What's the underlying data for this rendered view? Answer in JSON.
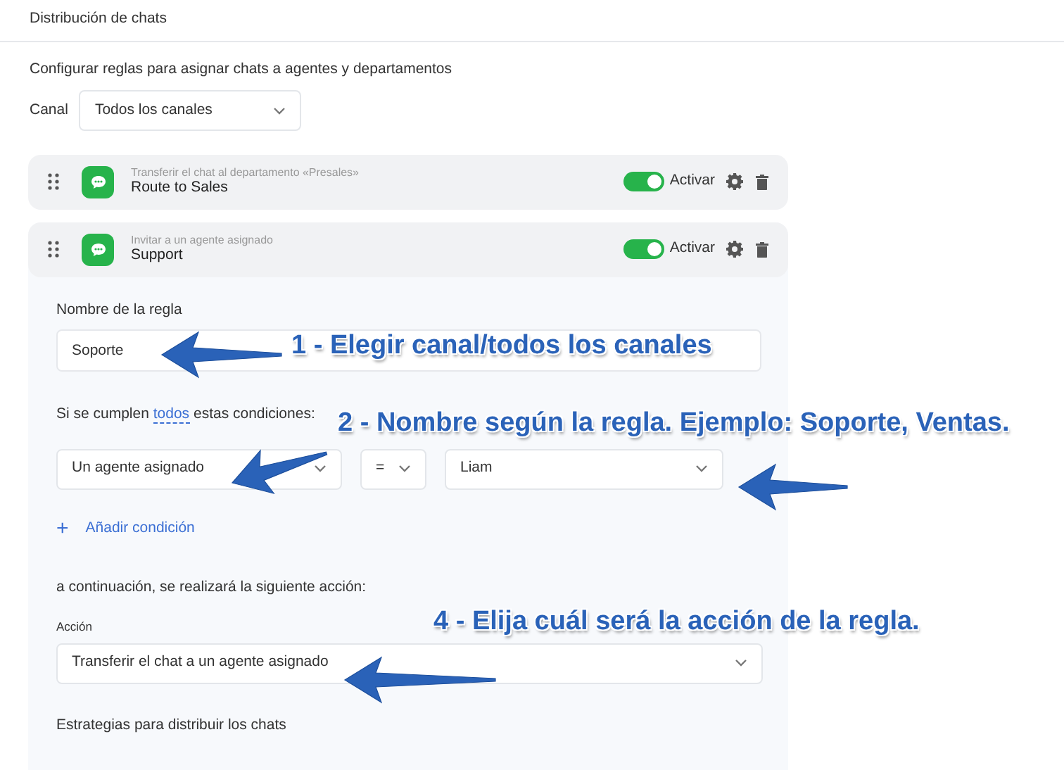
{
  "page": {
    "title": "Distribución de chats",
    "description": "Configurar reglas para asignar chats a agentes y departamentos"
  },
  "channel": {
    "label": "Canal",
    "value": "Todos los canales"
  },
  "rules": [
    {
      "action_summary": "Transferir el chat al departamento «Presales»",
      "name": "Route to Sales",
      "on": true,
      "toggle_label": "Activar",
      "expanded": false
    },
    {
      "action_summary": "Invitar a un agente asignado",
      "name": "Support",
      "on": true,
      "toggle_label": "Activar",
      "expanded": true
    }
  ],
  "rule_editor": {
    "name_label": "Nombre de la regla",
    "name_value": "Soporte",
    "conditions_text": [
      "Si se cumplen",
      "todos",
      "estas condiciones:"
    ],
    "conditions": [
      {
        "field": "Un agente asignado",
        "operator": "=",
        "value": "Liam"
      }
    ],
    "add_condition": {
      "icon": "+",
      "label": "Añadir condición"
    },
    "then_text": "a continuación, se realizará la siguiente acción:",
    "action_label": "Acción",
    "action_value": "Transferir el chat a un agente asignado",
    "strategies_label": "Estrategias para distribuir los chats"
  },
  "annotations": [
    {
      "text": "1 - Elegir canal/todos los canales"
    },
    {
      "text": "2 - Nombre según la regla. Ejemplo: Soporte, Ventas."
    },
    {
      "text": "4 - Elija cuál será la acción de la regla."
    }
  ]
}
